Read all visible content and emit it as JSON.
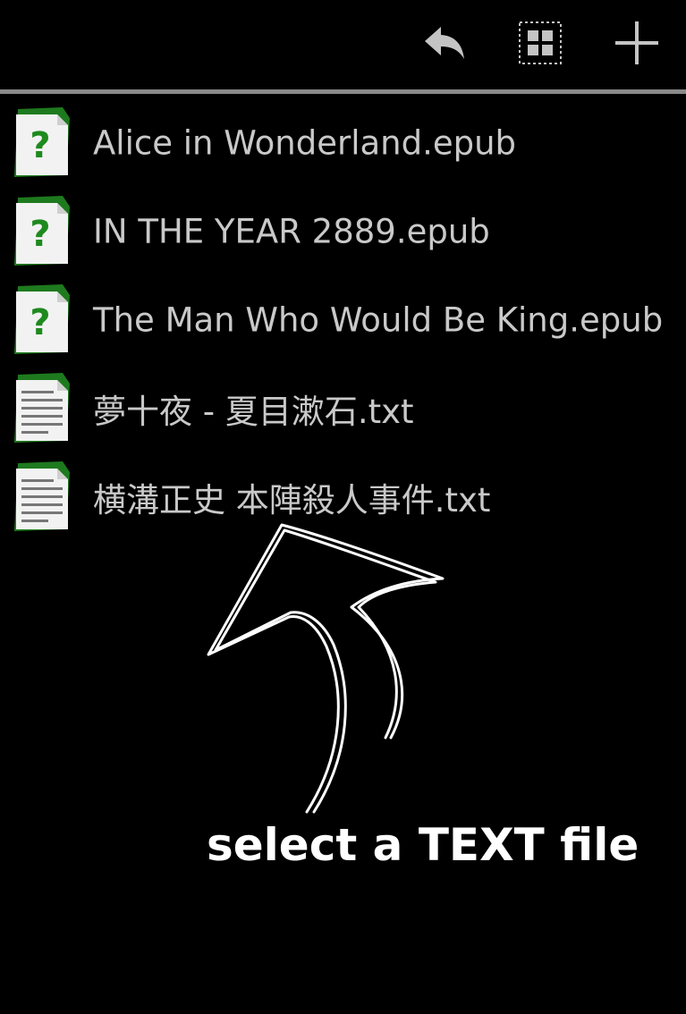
{
  "toolbar": {
    "actions": [
      {
        "name": "back-arrow-icon"
      },
      {
        "name": "grid-view-icon"
      },
      {
        "name": "add-icon"
      }
    ]
  },
  "files": [
    {
      "name": "Alice in Wonderland.epub",
      "icon": "unknown-file-icon"
    },
    {
      "name": "IN THE YEAR 2889.epub",
      "icon": "unknown-file-icon"
    },
    {
      "name": "The Man Who Would Be King.epub",
      "icon": "unknown-file-icon"
    },
    {
      "name": "夢十夜 - 夏目漱石.txt",
      "icon": "text-file-icon"
    },
    {
      "name": "横溝正史 本陣殺人事件.txt",
      "icon": "text-file-icon"
    }
  ],
  "annotation": {
    "text": "select a TEXT file",
    "icon": "curved-arrow-icon"
  },
  "colors": {
    "background": "#000000",
    "text": "#c9c9c9",
    "divider": "#8a8a8a",
    "icon_green": "#1e7a1e"
  }
}
